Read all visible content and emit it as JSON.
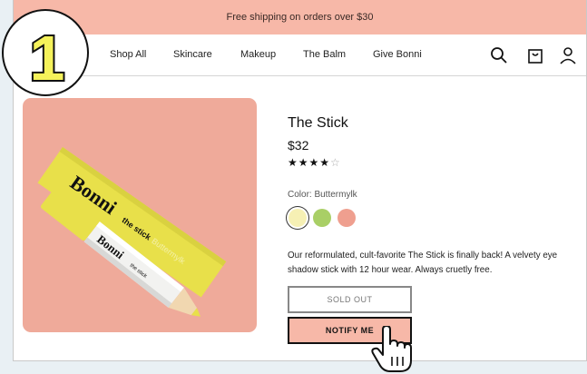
{
  "promo": {
    "text": "Free shipping on orders over $30"
  },
  "step": {
    "number": "1"
  },
  "nav": {
    "links": [
      "Shop All",
      "Skincare",
      "Makeup",
      "The Balm",
      "Give Bonni"
    ],
    "icons": [
      "search-icon",
      "bag-icon",
      "account-icon"
    ]
  },
  "product": {
    "image": {
      "brand": "Bonni",
      "name": "the stick",
      "shade": "Buttermylk"
    },
    "title": "The Stick",
    "price": "$32",
    "rating": 4,
    "rating_max": 5,
    "stars_filled": "★★★★",
    "stars_empty": "☆",
    "color_label": "Color: Buttermylk",
    "swatches": [
      {
        "name": "Buttermylk",
        "color": "#f6f0b4",
        "selected": true
      },
      {
        "name": "Green",
        "color": "#a9cf66",
        "selected": false
      },
      {
        "name": "Coral",
        "color": "#ef9f8f",
        "selected": false
      }
    ],
    "description": "Our reformulated, cult-favorite The Stick is finally back! A velvety eye shadow stick with 12 hour wear. Always cruetly free.",
    "sold_out_label": "SOLD OUT",
    "notify_label": "NOTIFY ME"
  },
  "colors": {
    "accent": "#f7b8a8",
    "image_bg": "#efaa9a",
    "product_yellow": "#e8e04a"
  }
}
